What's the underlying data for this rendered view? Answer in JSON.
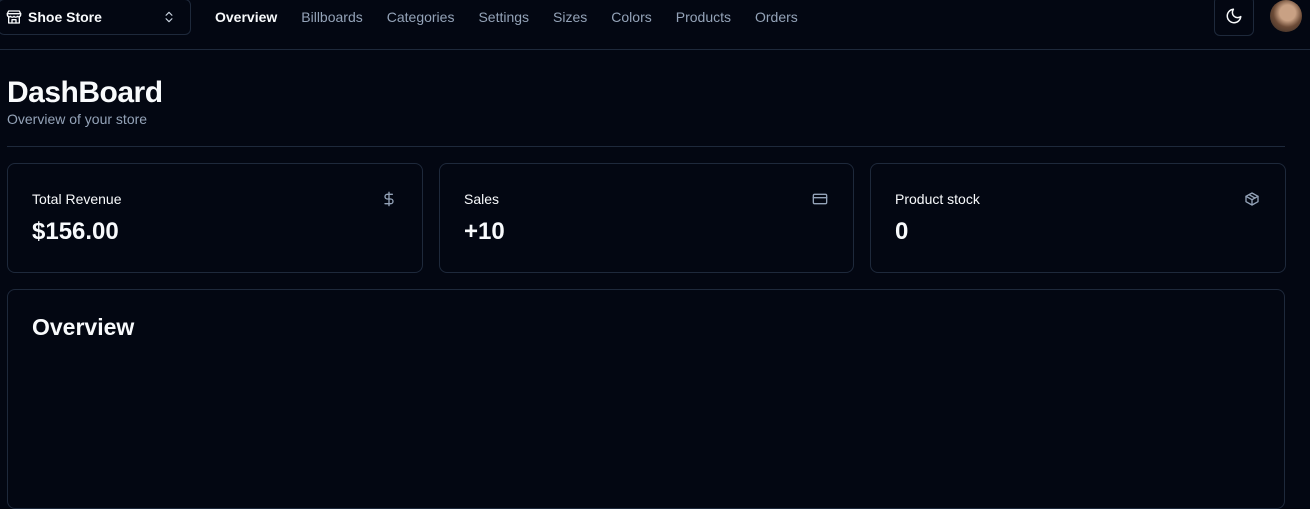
{
  "store_switcher": {
    "name": "Shoe Store",
    "icon": "store-icon",
    "chevron_icon": "chevrons-up-down-icon"
  },
  "nav": {
    "items": [
      {
        "label": "Overview",
        "active": true
      },
      {
        "label": "Billboards",
        "active": false
      },
      {
        "label": "Categories",
        "active": false
      },
      {
        "label": "Settings",
        "active": false
      },
      {
        "label": "Sizes",
        "active": false
      },
      {
        "label": "Colors",
        "active": false
      },
      {
        "label": "Products",
        "active": false
      },
      {
        "label": "Orders",
        "active": false
      }
    ]
  },
  "header_actions": {
    "theme_icon": "moon-icon",
    "avatar_icon": "user-avatar"
  },
  "page": {
    "title": "DashBoard",
    "subtitle": "Overview of your store"
  },
  "cards": [
    {
      "title": "Total Revenue",
      "value": "$156.00",
      "icon": "dollar-sign-icon"
    },
    {
      "title": "Sales",
      "value": "+10",
      "icon": "credit-card-icon"
    },
    {
      "title": "Product stock",
      "value": "0",
      "icon": "package-icon"
    }
  ],
  "overview": {
    "title": "Overview"
  },
  "colors": {
    "background": "#030712",
    "border": "#1e293b",
    "text": "#f8fafc",
    "muted_text": "#94a3b8"
  }
}
